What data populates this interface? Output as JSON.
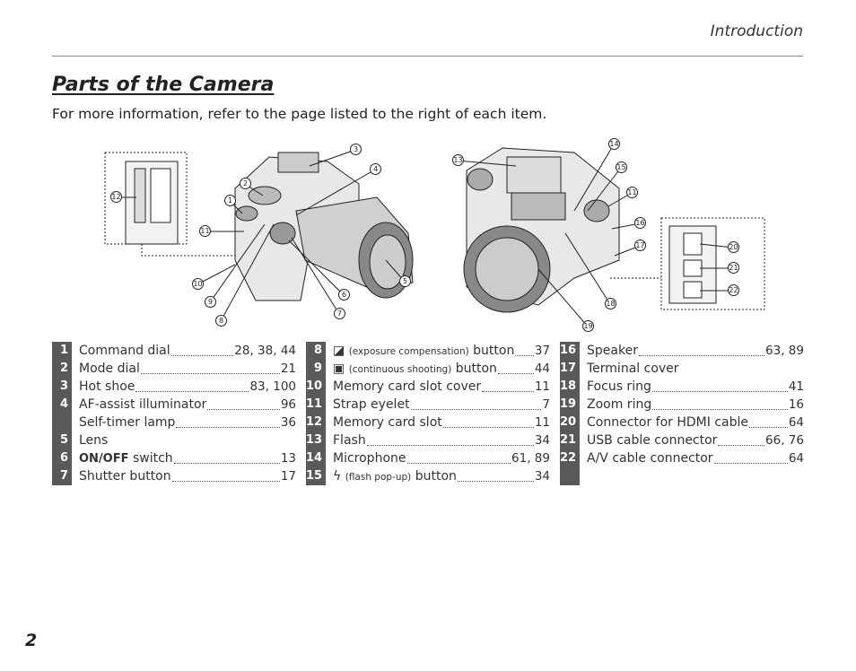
{
  "header": {
    "section": "Introduction"
  },
  "title": "Parts of the Camera",
  "subtitle": "For more information, refer to the page listed to the right of each item.",
  "page_number": "2",
  "callouts": [
    "1",
    "2",
    "3",
    "4",
    "5",
    "6",
    "7",
    "8",
    "9",
    "10",
    "11",
    "12",
    "13",
    "14",
    "15",
    "11",
    "16",
    "17",
    "18",
    "19",
    "20",
    "21",
    "22"
  ],
  "columns": [
    [
      {
        "num": "1",
        "label": "Command dial",
        "pages": "28, 38, 44"
      },
      {
        "num": "2",
        "label": "Mode dial",
        "pages": "21"
      },
      {
        "num": "3",
        "label": "Hot shoe",
        "pages": "83, 100"
      },
      {
        "num": "4",
        "label": "AF-assist illuminator",
        "pages": "96"
      },
      {
        "num": "",
        "label": "Self-timer lamp",
        "pages": "36"
      },
      {
        "num": "5",
        "label": "Lens",
        "pages": ""
      },
      {
        "num": "6",
        "label_bold": "ON/OFF",
        "label": " switch",
        "pages": "13"
      },
      {
        "num": "7",
        "label": "Shutter button",
        "pages": "17"
      }
    ],
    [
      {
        "num": "8",
        "icon": "exposure-compensation-icon",
        "note": "(exposure compensation)",
        "label": " button",
        "pages": "37"
      },
      {
        "num": "9",
        "icon": "continuous-shooting-icon",
        "note": "(continuous shooting)",
        "label": " button",
        "pages": "44"
      },
      {
        "num": "10",
        "label": "Memory card slot cover",
        "pages": "11"
      },
      {
        "num": "11",
        "label": "Strap eyelet",
        "pages": "7"
      },
      {
        "num": "12",
        "label": "Memory card slot",
        "pages": "11"
      },
      {
        "num": "13",
        "label": "Flash",
        "pages": "34"
      },
      {
        "num": "14",
        "label": "Microphone",
        "pages": "61, 89"
      },
      {
        "num": "15",
        "icon": "flash-icon",
        "note": "(flash pop-up)",
        "label": " button",
        "pages": "34"
      }
    ],
    [
      {
        "num": "16",
        "label": "Speaker",
        "pages": "63, 89"
      },
      {
        "num": "17",
        "label": "Terminal cover",
        "pages": ""
      },
      {
        "num": "18",
        "label": "Focus ring",
        "pages": "41"
      },
      {
        "num": "19",
        "label": "Zoom ring",
        "pages": "16"
      },
      {
        "num": "20",
        "label": "Connector for HDMI cable",
        "pages": "64"
      },
      {
        "num": "21",
        "label": "USB cable connector",
        "pages": "66, 76"
      },
      {
        "num": "22",
        "label": "A/V cable connector",
        "pages": "64"
      }
    ]
  ]
}
